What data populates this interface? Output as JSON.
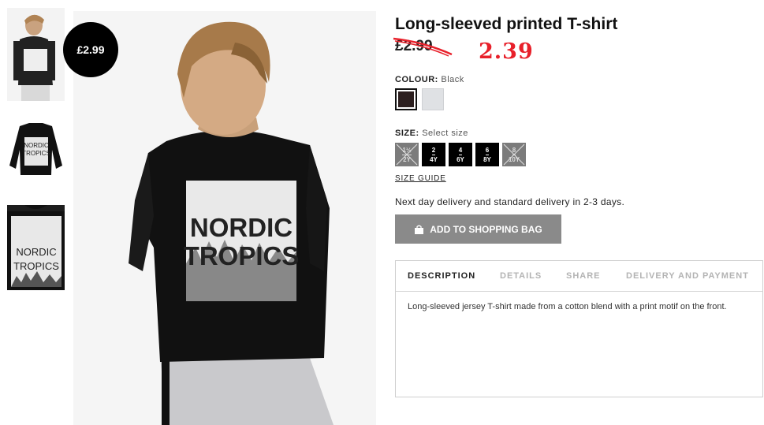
{
  "product": {
    "title": "Long-sleeved printed T-shirt",
    "old_price": "£2.99",
    "new_price": "2.39",
    "badge_price": "£2.99",
    "print_line1": "NORDIC",
    "print_line2": "TROPICS"
  },
  "colour": {
    "label": "COLOUR:",
    "value": "Black",
    "swatches": [
      {
        "name": "Black",
        "hex": "#2c1f1f",
        "selected": true
      },
      {
        "name": "Grey",
        "hex": "#dfe1e4",
        "selected": false
      }
    ]
  },
  "size": {
    "label": "SIZE:",
    "value": "Select size",
    "options": [
      {
        "line1": "1½",
        "line2": "2Y",
        "available": false
      },
      {
        "line1": "2",
        "line2": "4Y",
        "available": true
      },
      {
        "line1": "4",
        "line2": "6Y",
        "available": true
      },
      {
        "line1": "6",
        "line2": "8Y",
        "available": true
      },
      {
        "line1": "8",
        "line2": "10Y",
        "available": false
      }
    ],
    "guide": "SIZE GUIDE"
  },
  "delivery": "Next day delivery and standard delivery in 2-3 days.",
  "add_to_bag": "ADD TO SHOPPING BAG",
  "tabs": [
    "DESCRIPTION",
    "DETAILS",
    "SHARE",
    "DELIVERY AND PAYMENT"
  ],
  "description": "Long-sleeved jersey T-shirt made from a cotton blend with a print motif on the front.",
  "colors": {
    "accent_red": "#e8202a",
    "button_grey": "#8a8a8a",
    "disabled_size": "#7b7b7b"
  }
}
